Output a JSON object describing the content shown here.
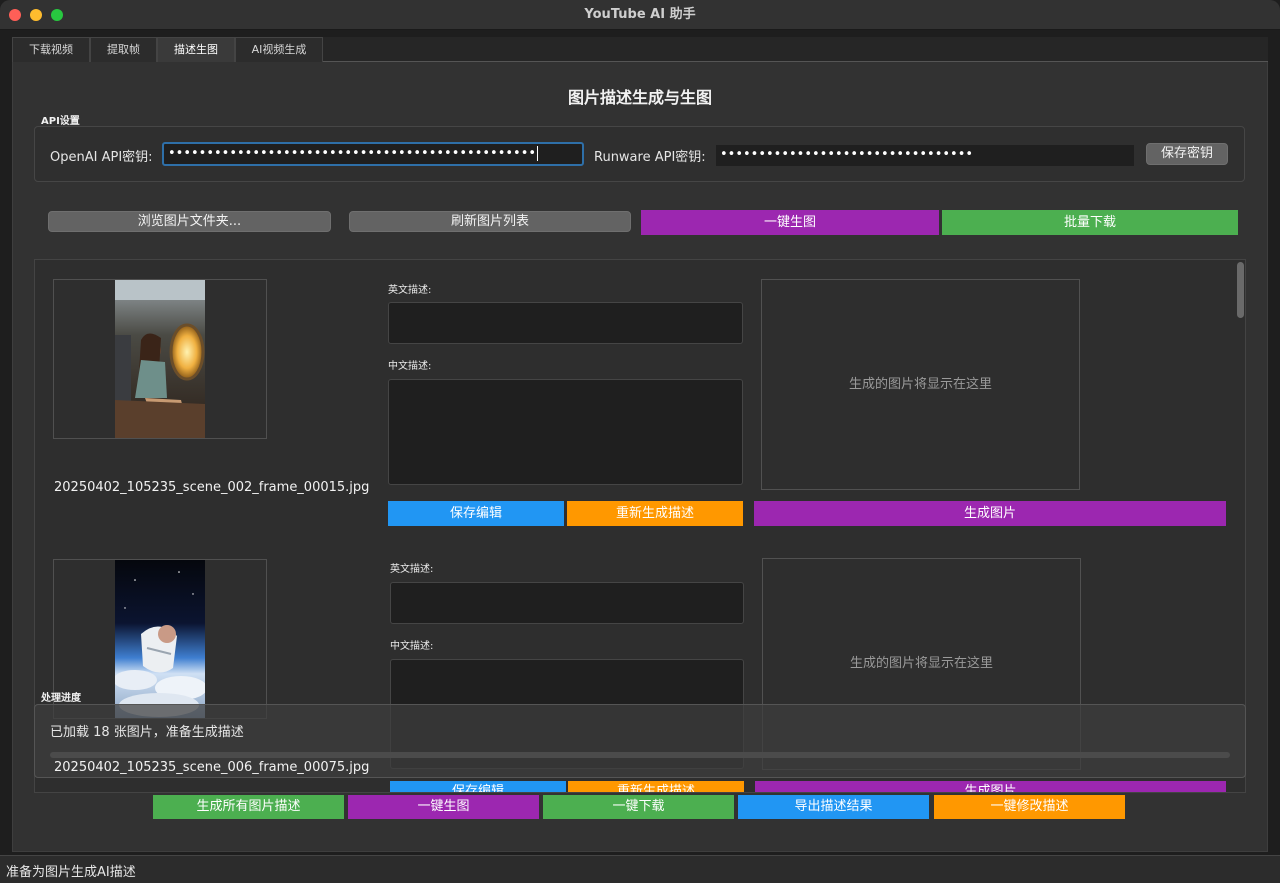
{
  "window": {
    "title": "YouTube AI 助手"
  },
  "tabs": [
    {
      "label": "下载视频"
    },
    {
      "label": "提取帧"
    },
    {
      "label": "描述生图"
    },
    {
      "label": "AI视频生成"
    }
  ],
  "page_title": "图片描述生成与生图",
  "api": {
    "group_label": "API设置",
    "openai_label": "OpenAI API密钥:",
    "openai_value": "••••••••••••••••••••••••••••••••••••••••••••••••",
    "runware_label": "Runware API密钥:",
    "runware_value": "•••••••••••••••••••••••••••••••••",
    "save_label": "保存密钥"
  },
  "toolbar": {
    "browse_label": "浏览图片文件夹...",
    "refresh_label": "刷新图片列表",
    "gen_all_label": "一键生图",
    "batch_download_label": "批量下载"
  },
  "items": [
    {
      "filename": "20250402_105235_scene_002_frame_00015.jpg",
      "en_label": "英文描述:",
      "zh_label": "中文描述:",
      "placeholder": "生成的图片将显示在这里",
      "save_label": "保存编辑",
      "regen_label": "重新生成描述",
      "gen_label": "生成图片"
    },
    {
      "filename": "20250402_105235_scene_006_frame_00075.jpg",
      "en_label": "英文描述:",
      "zh_label": "中文描述:",
      "placeholder": "生成的图片将显示在这里",
      "save_label": "保存编辑",
      "regen_label": "重新生成描述",
      "gen_label": "生成图片"
    }
  ],
  "progress": {
    "group_label": "处理进度",
    "message": "已加载 18 张图片，准备生成描述",
    "value": 0
  },
  "bottom_buttons": {
    "gen_desc_label": "生成所有图片描述",
    "gen_img_label": "一键生图",
    "download_label": "一键下载",
    "export_label": "导出描述结果",
    "modify_label": "一键修改描述"
  },
  "status": "准备为图片生成AI描述",
  "colors": {
    "purple": "#9c27b0",
    "green": "#4caf50",
    "blue": "#2196f3",
    "orange": "#ff9800"
  }
}
